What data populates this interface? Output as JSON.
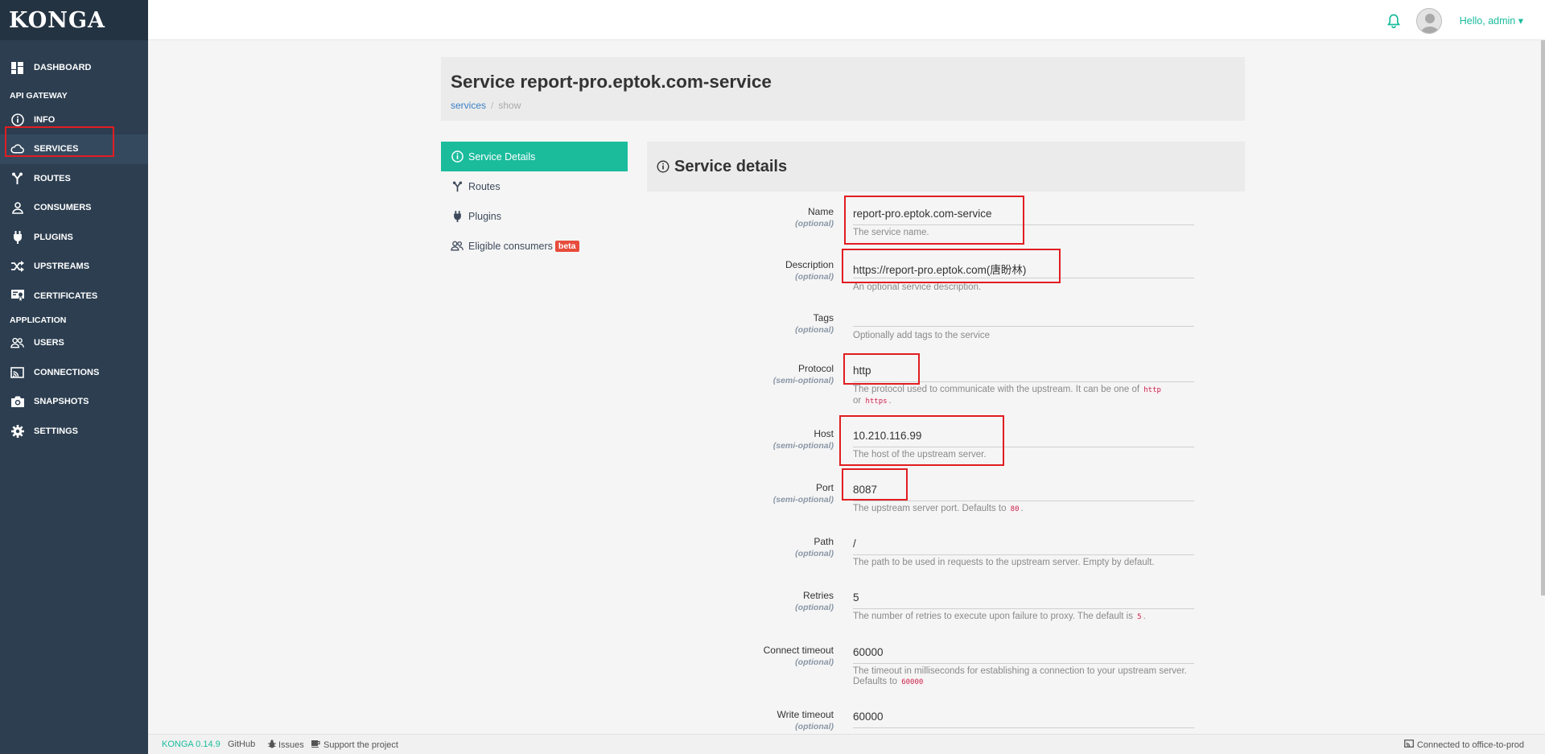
{
  "app": {
    "logo": "KONGA"
  },
  "sidebar": {
    "dashboard": "DASHBOARD",
    "section_gateway": "API GATEWAY",
    "gateway_items": [
      "INFO",
      "SERVICES",
      "ROUTES",
      "CONSUMERS",
      "PLUGINS",
      "UPSTREAMS",
      "CERTIFICATES"
    ],
    "section_application": "APPLICATION",
    "application_items": [
      "USERS",
      "CONNECTIONS",
      "SNAPSHOTS",
      "SETTINGS"
    ],
    "active_item": "SERVICES"
  },
  "topbar": {
    "user_label": "Hello, admin ▾"
  },
  "header": {
    "title": "Service report-pro.eptok.com-service",
    "breadcrumb": {
      "link": "services",
      "separator": "/",
      "current": "show"
    }
  },
  "subnav": {
    "items": [
      "Service Details",
      "Routes",
      "Plugins",
      "Eligible consumers"
    ],
    "badge": "beta",
    "active": "Service Details"
  },
  "details": {
    "heading": "Service details",
    "fields": [
      {
        "label": "Name",
        "opt": "(optional)",
        "value": "report-pro.eptok.com-service",
        "help": "The service name."
      },
      {
        "label": "Description",
        "opt": "(optional)",
        "value": "https://report-pro.eptok.com(唐盼林)",
        "help": "An optional service description."
      },
      {
        "label": "Tags",
        "opt": "(optional)",
        "value": "",
        "help": "Optionally add tags to the service"
      },
      {
        "label": "Protocol",
        "opt": "(semi-optional)",
        "value": "http",
        "help_pre": "The protocol used to communicate with the upstream. It can be one of",
        "code1": "http",
        "help_mid": "or",
        "code2": "https",
        "help_post": "."
      },
      {
        "label": "Host",
        "opt": "(semi-optional)",
        "value": "10.210.116.99",
        "help": "The host of the upstream server."
      },
      {
        "label": "Port",
        "opt": "(semi-optional)",
        "value": "8087",
        "help_pre": "The upstream server port. Defaults to",
        "code1": "80",
        "help_post": "."
      },
      {
        "label": "Path",
        "opt": "(optional)",
        "value": "/",
        "help": "The path to be used in requests to the upstream server. Empty by default."
      },
      {
        "label": "Retries",
        "opt": "(optional)",
        "value": "5",
        "help_pre": "The number of retries to execute upon failure to proxy. The default is",
        "code1": "5",
        "help_post": "."
      },
      {
        "label": "Connect timeout",
        "opt": "(optional)",
        "value": "60000",
        "help_pre": "The timeout in milliseconds for establishing a connection to your upstream server. Defaults to",
        "code1": "60000"
      },
      {
        "label": "Write timeout",
        "opt": "(optional)",
        "value": "60000"
      }
    ]
  },
  "footer": {
    "version": "KONGA 0.14.9",
    "github": "GitHub",
    "issues": "Issues",
    "support": "Support the project",
    "connection": "Connected to office-to-prod"
  },
  "colors": {
    "sidebar": "#2c3e50",
    "accent": "#1abc9c",
    "highlight": "#e11d21",
    "badge": "#e74c3c"
  }
}
